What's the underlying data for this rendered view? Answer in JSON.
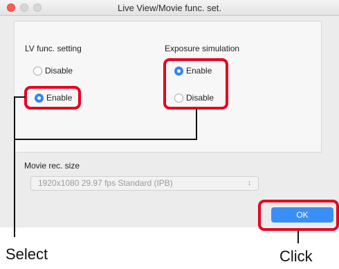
{
  "window": {
    "title": "Live View/Movie func. set."
  },
  "lv_func": {
    "label": "LV func. setting",
    "options": [
      {
        "label": "Disable",
        "selected": false
      },
      {
        "label": "Enable",
        "selected": true
      }
    ]
  },
  "exposure_sim": {
    "label": "Exposure simulation",
    "options": [
      {
        "label": "Enable",
        "selected": true
      },
      {
        "label": "Disable",
        "selected": false
      }
    ]
  },
  "movie": {
    "label": "Movie rec. size",
    "selected_value": "1920x1080 29.97 fps  Standard (IPB)"
  },
  "buttons": {
    "ok_label": "OK"
  },
  "annotations": {
    "select_caption": "Select",
    "click_caption": "Click",
    "highlight_color": "#e8001e"
  },
  "colors": {
    "accent": "#2f86f5",
    "ok_button": "#3a8ff6"
  }
}
